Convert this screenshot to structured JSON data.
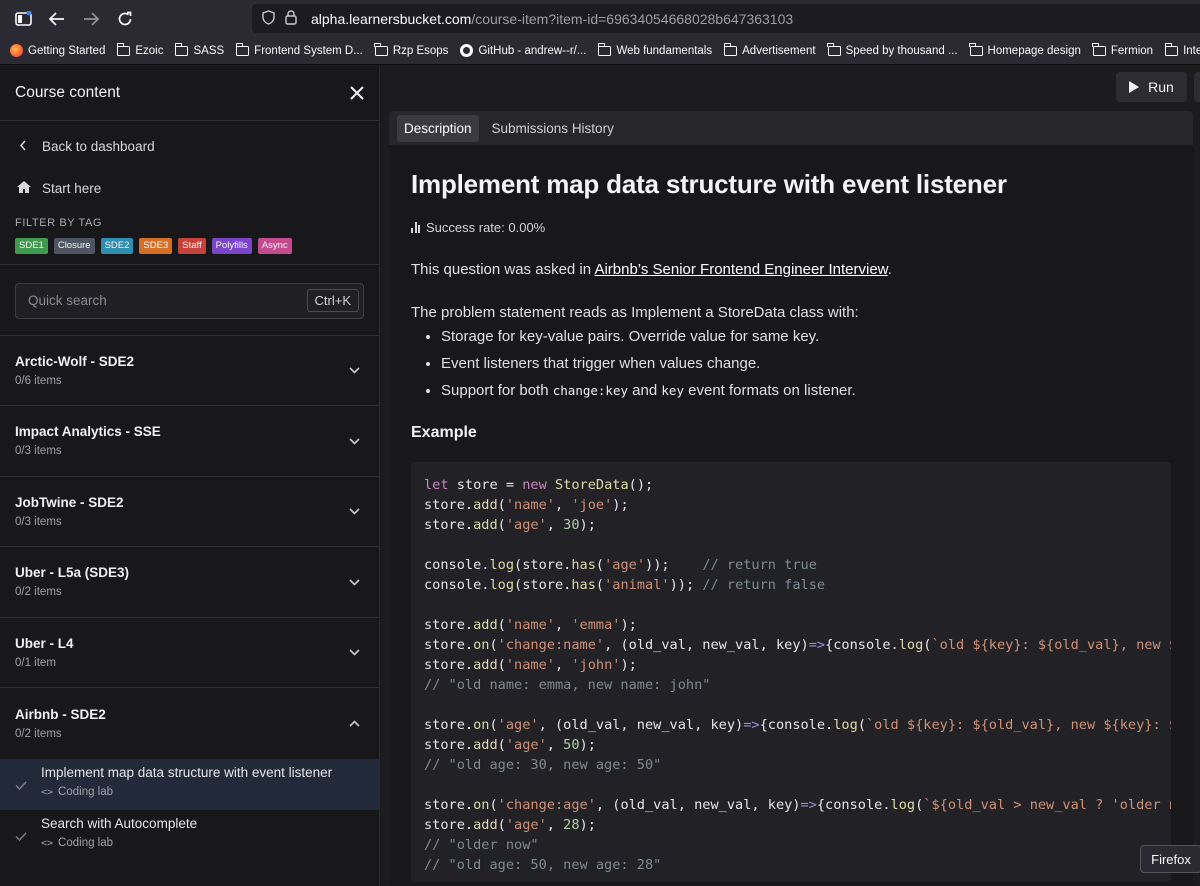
{
  "browser": {
    "url_host": "alpha.learnersbucket.com",
    "url_path": "/course-item?item-id=69634054668028b647363103",
    "bookmarks": [
      {
        "label": "Getting Started",
        "icon": "firefox-icon"
      },
      {
        "label": "Ezoic",
        "icon": "folder-icon"
      },
      {
        "label": "SASS",
        "icon": "folder-icon"
      },
      {
        "label": "Frontend System D...",
        "icon": "folder-icon"
      },
      {
        "label": "Rzp Esops",
        "icon": "folder-icon"
      },
      {
        "label": "GitHub - andrew--r/...",
        "icon": "github-icon"
      },
      {
        "label": "Web fundamentals",
        "icon": "folder-icon"
      },
      {
        "label": "Advertisement",
        "icon": "folder-icon"
      },
      {
        "label": "Speed by thousand ...",
        "icon": "folder-icon"
      },
      {
        "label": "Homepage design",
        "icon": "folder-icon"
      },
      {
        "label": "Fermion",
        "icon": "folder-icon"
      },
      {
        "label": "Intervi",
        "icon": "folder-icon"
      }
    ],
    "tooltip": "Firefox"
  },
  "sidebar": {
    "title": "Course content",
    "back_label": "Back to dashboard",
    "start_label": "Start here",
    "filter_label": "FILTER BY TAG",
    "tags": [
      {
        "label": "SDE1",
        "color": "#3f9a4f"
      },
      {
        "label": "Closure",
        "color": "#4f5560"
      },
      {
        "label": "SDE2",
        "color": "#2f8db0"
      },
      {
        "label": "SDE3",
        "color": "#d46f28"
      },
      {
        "label": "Staff",
        "color": "#c4423a"
      },
      {
        "label": "Polyfills",
        "color": "#7a45c8"
      },
      {
        "label": "Async",
        "color": "#c24a8e"
      }
    ],
    "search_placeholder": "Quick search",
    "search_shortcut": "Ctrl+K",
    "groups": [
      {
        "title": "Arctic-Wolf - SDE2",
        "count": "0/6 items"
      },
      {
        "title": "Impact Analytics - SSE",
        "count": "0/3 items"
      },
      {
        "title": "JobTwine - SDE2",
        "count": "0/3 items"
      },
      {
        "title": "Uber - L5a (SDE3)",
        "count": "0/2 items"
      },
      {
        "title": "Uber - L4",
        "count": "0/1 item"
      },
      {
        "title": "Airbnb - SDE2",
        "count": "0/2 items"
      }
    ],
    "items": [
      {
        "title": "Implement map data structure with event listener",
        "type": "Coding lab"
      },
      {
        "title": "Search with Autocomplete",
        "type": "Coding lab"
      }
    ]
  },
  "toolbar": {
    "run_label": "Run"
  },
  "tabs": {
    "description": "Description",
    "history": "Submissions History"
  },
  "problem": {
    "title": "Implement map data structure with event listener",
    "success_rate": "Success rate: 0.00%",
    "asked_prefix": "This question was asked in ",
    "asked_link": "Airbnb’s Senior Frontend Engineer Interview",
    "asked_suffix": ".",
    "statement": "The problem statement reads as Implement a StoreData class with:",
    "bullet_1": "Storage for key-value pairs. Override value for same key.",
    "bullet_2": "Event listeners that trigger when values change.",
    "bullet_3_prefix": "Support for both ",
    "bullet_3_code1": "change:key",
    "bullet_3_mid": " and ",
    "bullet_3_code2": "key",
    "bullet_3_suffix": " event formats on listener.",
    "example_heading": "Example"
  },
  "code_lines": [
    "let store = new StoreData();",
    "store.add('name', 'joe');",
    "store.add('age', 30);",
    "",
    "console.log(store.has('age'));    // return true",
    "console.log(store.has('animal')); // return false",
    "",
    "store.add('name', 'emma');",
    "store.on('change:name', (old_val, new_val, key)=>{console.log(`old ${key}: ${old_val}, new ${key}: ${new_val}`)});",
    "store.add('name', 'john');",
    "// \"old name: emma, new name: john\"",
    "",
    "store.on('age', (old_val, new_val, key)=>{console.log(`old ${key}: ${old_val}, new ${key}: ${new_val}`)});",
    "store.add('age', 50);",
    "// \"old age: 30, new age: 50\"",
    "",
    "store.on('change:age', (old_val, new_val, key)=>{console.log(`${old_val > new_val ? 'older now' : 'younger now'}`)});",
    "store.add('age', 28);",
    "// \"older now\"",
    "// \"old age: 50, new age: 28\""
  ]
}
